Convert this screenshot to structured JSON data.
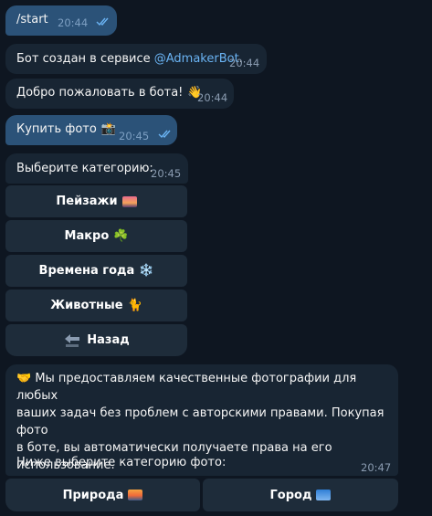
{
  "messages": {
    "m1": {
      "text": "/start",
      "time": "20:44"
    },
    "m2": {
      "text_prefix": "Бот создан в сервисе ",
      "link": "@AdmakerBot",
      "text_suffix": ".",
      "time": "20:44"
    },
    "m3": {
      "text": "Добро пожаловать в бота!",
      "emoji": "👋",
      "time": "20:44"
    },
    "m4": {
      "text": "Купить фото",
      "emoji": "📸",
      "time": "20:45"
    },
    "m5": {
      "text": "Выберите категорию:",
      "time": "20:45",
      "buttons": [
        {
          "label": "Пейзажи",
          "emoji": "🌄"
        },
        {
          "label": "Макро",
          "emoji": "☘️"
        },
        {
          "label": "Времена года",
          "emoji": "❄️"
        },
        {
          "label": "Животные",
          "emoji": "🐈"
        },
        {
          "label": "Назад",
          "emoji": "🔙"
        }
      ]
    },
    "m6": {
      "lines": [
        "🤝 Мы предоставляем качественные фотографии для любых",
        "ваших задач без проблем с авторскими правами. Покупая фото",
        "в боте, вы автоматически получаете права на его",
        "использование."
      ],
      "footer": "Ниже выберите категорию фото:",
      "time": "20:47",
      "buttons": [
        {
          "label": "Природа",
          "emoji": "🌅"
        },
        {
          "label": "Город",
          "emoji": "🏙"
        }
      ]
    }
  },
  "colors": {
    "background": "#0e1621",
    "outgoing_bubble": "#2b5278",
    "incoming_bubble": "#182533",
    "keyboard_button": "#1e2c3a",
    "link": "#6ab3f3"
  }
}
